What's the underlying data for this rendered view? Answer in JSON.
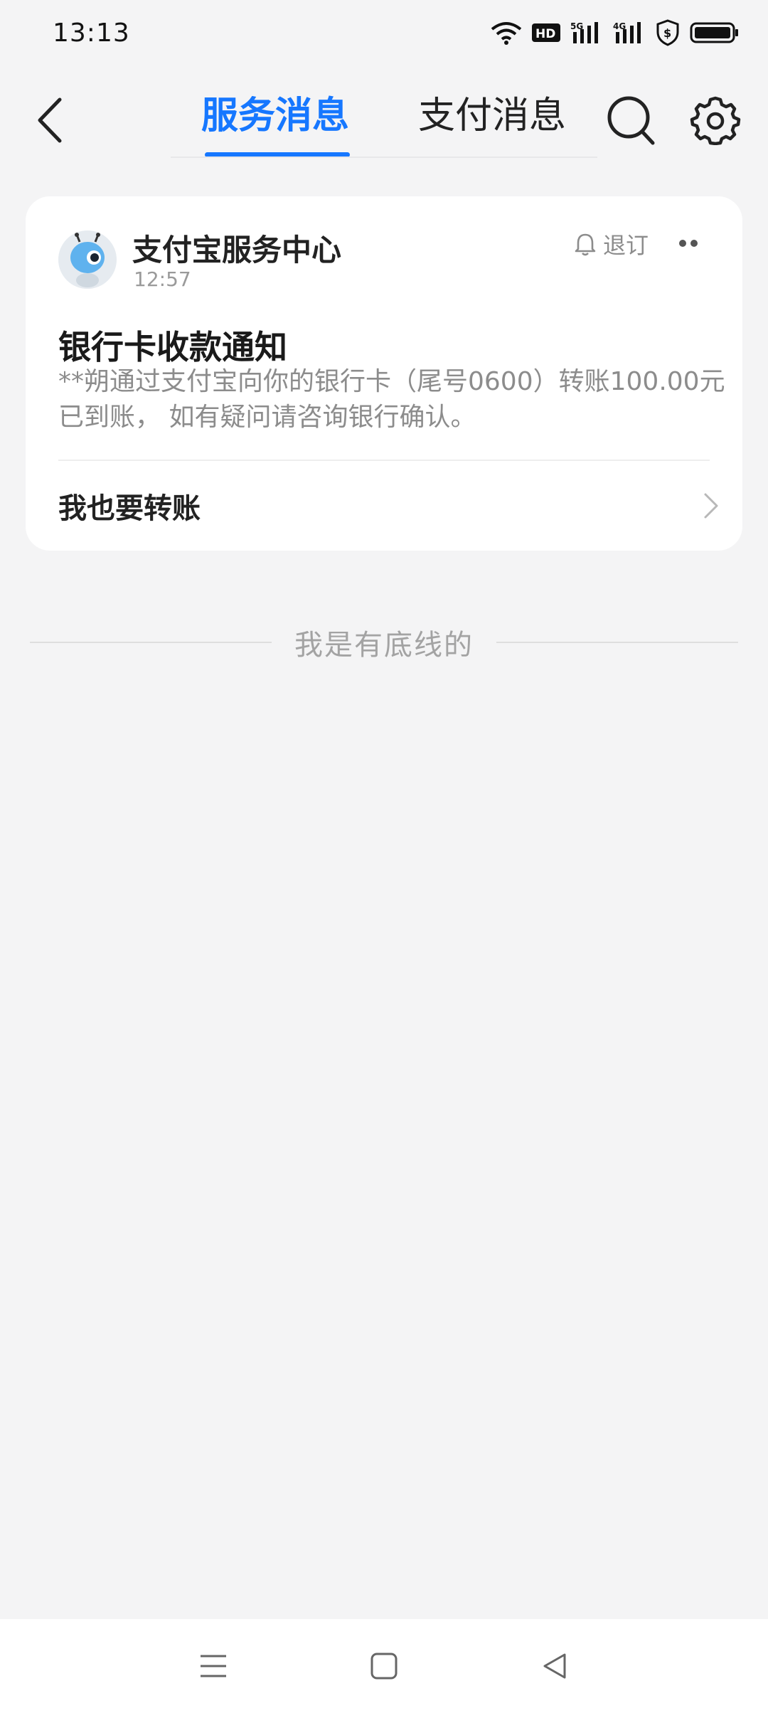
{
  "status_bar": {
    "time": "13:13",
    "icons": [
      "wifi-icon",
      "hd-icon",
      "signal-5g-icon",
      "signal-4g-icon",
      "shield-dollar-icon",
      "battery-icon"
    ],
    "hd_label": "HD",
    "net1_label": "5G",
    "net2_label": "4G"
  },
  "header": {
    "tabs": [
      {
        "label": "服务消息",
        "active": true
      },
      {
        "label": "支付消息",
        "active": false
      }
    ],
    "accent_color": "#1677ff"
  },
  "card": {
    "sender": "支付宝服务中心",
    "time": "12:57",
    "unsubscribe_label": "退订",
    "title": "银行卡收款通知",
    "body": "**朔通过支付宝向你的银行卡（尾号0600）转账100.00元已到账， 如有疑问请咨询银行确认。",
    "action_label": "我也要转账"
  },
  "footer": {
    "end_text": "我是有底线的"
  }
}
